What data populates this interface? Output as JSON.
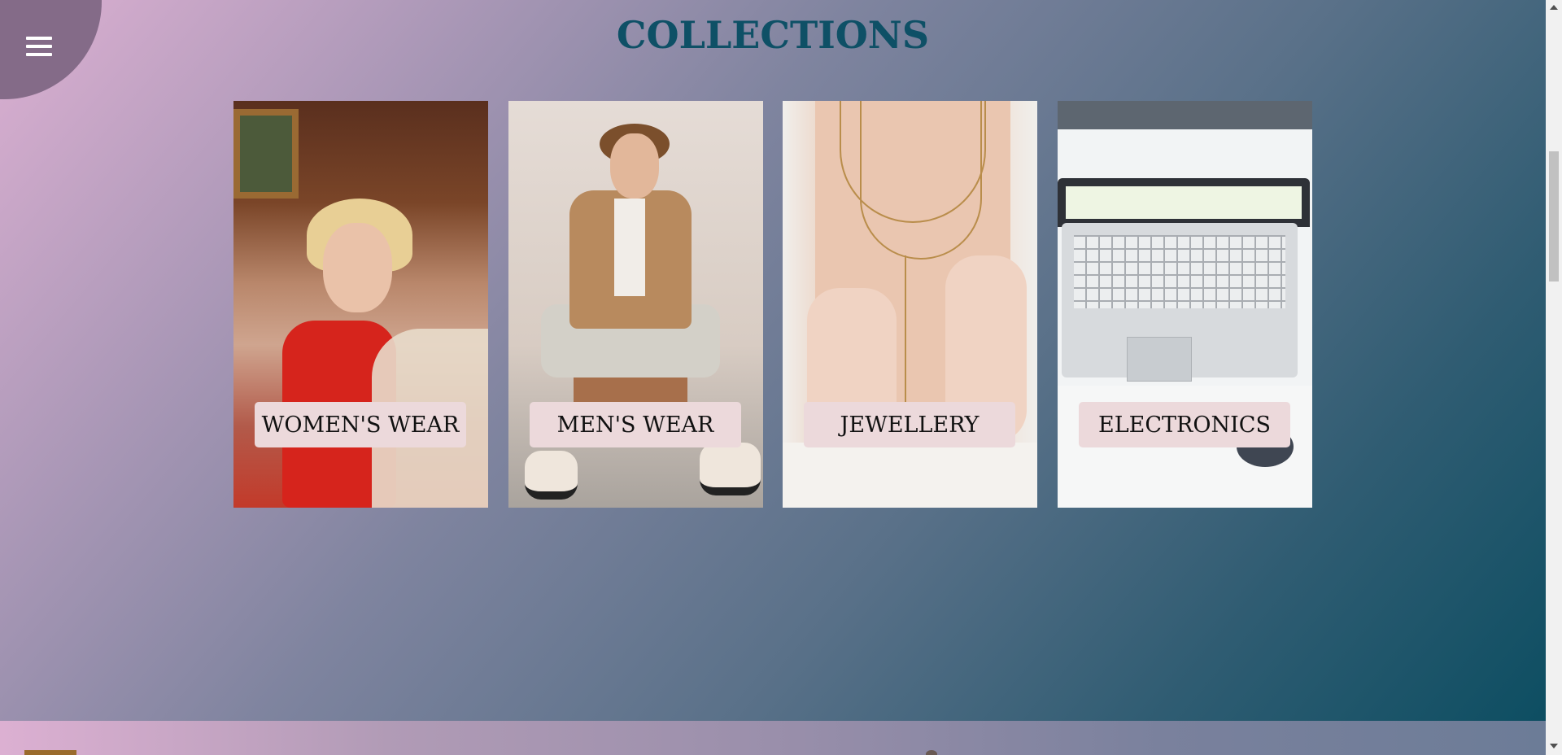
{
  "page": {
    "title": "COLLECTIONS",
    "accent_color": "#0e5066",
    "label_bg_color": "#ecd9db"
  },
  "nav": {
    "menu_icon": "hamburger-menu-icon"
  },
  "collections": [
    {
      "label": "WOMEN'S WEAR",
      "image": "woman-in-red-dress"
    },
    {
      "label": "MEN'S WEAR",
      "image": "man-in-tan-blazer"
    },
    {
      "label": "JEWELLERY",
      "image": "gold-necklaces-and-rings"
    },
    {
      "label": "ELECTRONICS",
      "image": "laptop-on-desk"
    }
  ]
}
